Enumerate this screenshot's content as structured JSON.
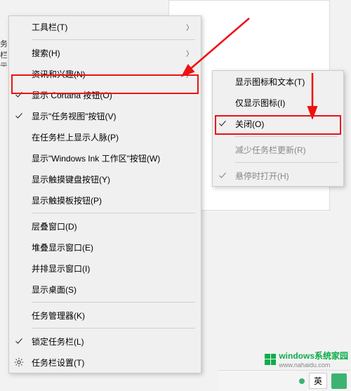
{
  "main_menu": {
    "toolbars": "工具栏(T)",
    "search": "搜索(H)",
    "news": "资讯和兴趣(N)",
    "cortana": "显示 Cortana 按钮(O)",
    "taskview": "显示\"任务视图\"按钮(V)",
    "people": "在任务栏上显示人脉(P)",
    "ink": "显示\"Windows Ink 工作区\"按钮(W)",
    "touchkbd": "显示触摸键盘按钮(Y)",
    "touchpad": "显示触摸板按钮(P)",
    "cascade": "层叠窗口(D)",
    "stackh": "堆叠显示窗口(E)",
    "sidebyside": "并排显示窗口(I)",
    "desktop": "显示桌面(S)",
    "taskmgr": "任务管理器(K)",
    "lock": "锁定任务栏(L)",
    "settings": "任务栏设置(T)"
  },
  "sub_menu": {
    "icon_text": "显示图标和文本(T)",
    "icon_only": "仅显示图标(I)",
    "close": "关闭(O)",
    "reduce": "减少任务栏更新(R)",
    "hover_open": "悬停时打开(H)"
  },
  "taskbar": {
    "ime": "英"
  },
  "watermark": {
    "line1": "windows系统家园",
    "line2": "www.nahaidu.com"
  },
  "left_fragment": "务栏\n示"
}
